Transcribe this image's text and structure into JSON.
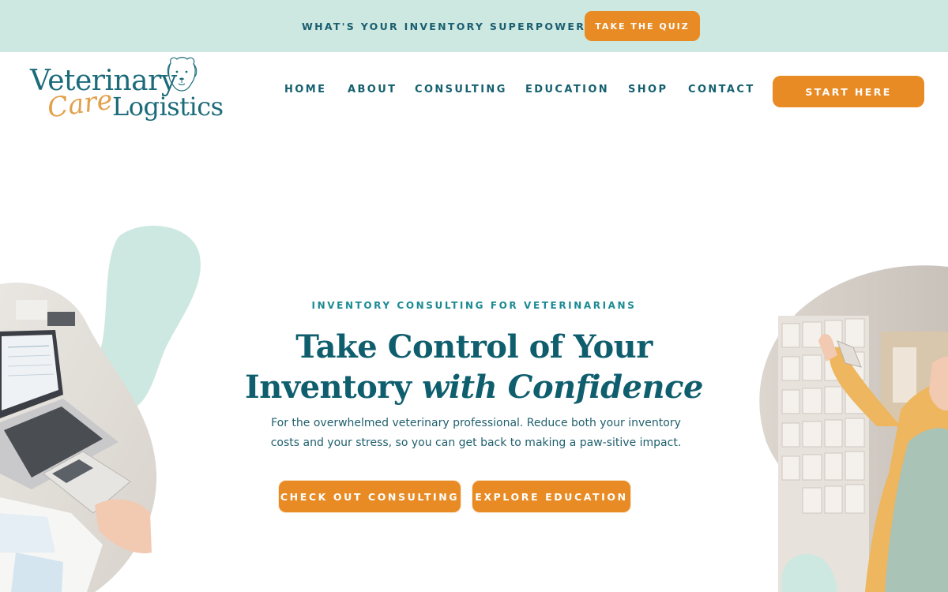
{
  "promo": {
    "text": "WHAT'S YOUR INVENTORY SUPERPOWER?",
    "button_label": "TAKE THE QUIZ"
  },
  "logo": {
    "line1": "Veterinary",
    "script_word": "Care",
    "line2": "Logistics"
  },
  "nav": {
    "items": [
      {
        "label": "HOME"
      },
      {
        "label": "ABOUT"
      },
      {
        "label": "CONSULTING"
      },
      {
        "label": "EDUCATION"
      },
      {
        "label": "SHOP"
      },
      {
        "label": "CONTACT"
      }
    ],
    "cta_label": "START HERE"
  },
  "hero": {
    "eyebrow": "INVENTORY CONSULTING FOR VETERINARIANS",
    "title_line1": "Take Control of Your",
    "title_line2_plain": "Inventory ",
    "title_line2_italic": "with Confidence",
    "description": "For the overwhelmed veterinary professional. Reduce both your inventory costs and your stress, so you can get back to making a paw-sitive impact.",
    "buttons": [
      {
        "label": "CHECK OUT CONSULTING"
      },
      {
        "label": "EXPLORE EDUCATION"
      }
    ]
  },
  "colors": {
    "accent_orange": "#e88b25",
    "primary_teal": "#0f5e6e",
    "mint": "#cde8e0",
    "eyebrow_teal": "#1c8a93"
  }
}
